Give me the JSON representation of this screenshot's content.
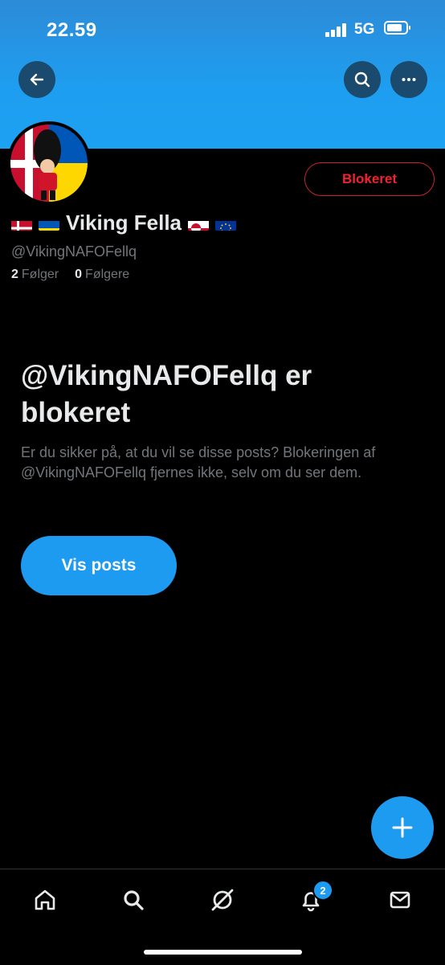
{
  "status_bar": {
    "time": "22.59",
    "network": "5G"
  },
  "header": {
    "back_icon": "arrow-left-icon",
    "search_icon": "search-icon",
    "more_icon": "more-horizontal-icon"
  },
  "profile": {
    "name": "Viking Fella",
    "handle": "@VikingNAFOFellq",
    "following_count": "2",
    "following_label": "Følger",
    "followers_count": "0",
    "followers_label": "Følgere",
    "blocked_button_label": "Blokeret",
    "name_flags_before": [
      "denmark-flag",
      "ukraine-flag"
    ],
    "name_flags_after": [
      "greenland-flag",
      "eu-flag"
    ]
  },
  "blocked_notice": {
    "title": "@VikingNAFOFellq er blokeret",
    "description": "Er du sikker på, at du vil se disse posts? Blokeringen af @VikingNAFOFellq fjernes ikke, selv om du ser dem.",
    "button_label": "Vis posts"
  },
  "tab_bar": {
    "items": [
      {
        "icon": "home-icon"
      },
      {
        "icon": "search-icon"
      },
      {
        "icon": "grok-icon"
      },
      {
        "icon": "bell-icon",
        "badge": "2"
      },
      {
        "icon": "mail-icon"
      }
    ]
  },
  "colors": {
    "accent": "#1d9bf0",
    "blocked_red": "#f4212e",
    "background": "#000000",
    "muted_text": "#71767b"
  }
}
